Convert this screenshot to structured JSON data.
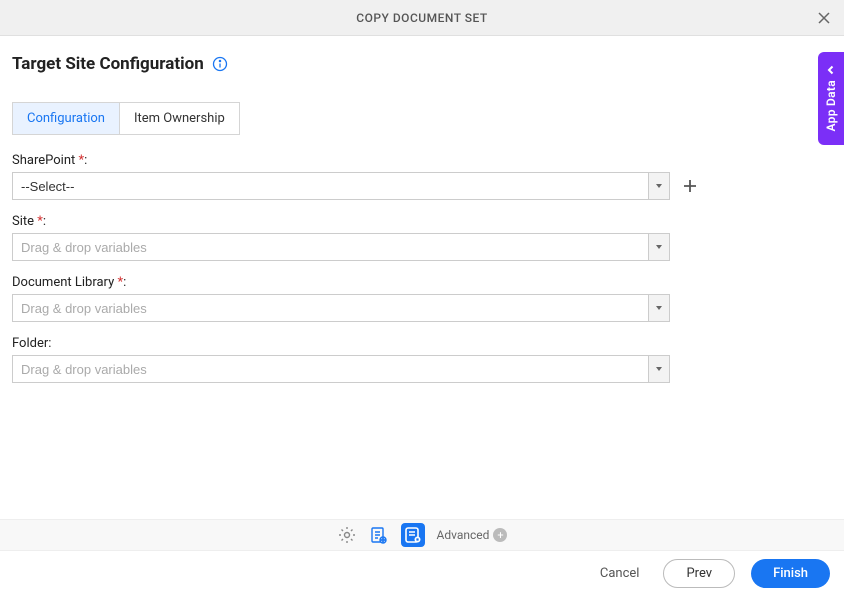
{
  "header": {
    "title": "COPY DOCUMENT SET"
  },
  "page": {
    "title": "Target Site Configuration"
  },
  "tabs": [
    {
      "label": "Configuration",
      "active": true
    },
    {
      "label": "Item Ownership",
      "active": false
    }
  ],
  "fields": {
    "sharepoint": {
      "label": "SharePoint",
      "required": true,
      "value": "--Select--",
      "placeholder": ""
    },
    "site": {
      "label": "Site",
      "required": true,
      "value": "",
      "placeholder": "Drag & drop variables"
    },
    "documentLibrary": {
      "label": "Document Library",
      "required": true,
      "value": "",
      "placeholder": "Drag & drop variables"
    },
    "folder": {
      "label": "Folder",
      "required": false,
      "value": "",
      "placeholder": "Drag & drop variables"
    }
  },
  "toolbar": {
    "advanced": "Advanced"
  },
  "footer": {
    "cancel": "Cancel",
    "prev": "Prev",
    "finish": "Finish"
  },
  "sidePanel": {
    "label": "App Data"
  }
}
